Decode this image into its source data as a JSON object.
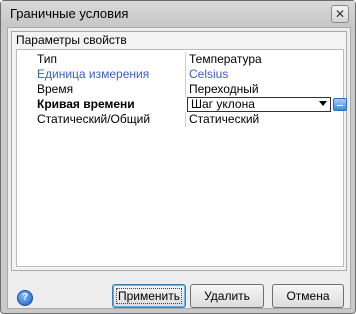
{
  "window": {
    "title": "Граничные условия",
    "close_glyph": "✕"
  },
  "group": {
    "title": "Параметры свойств"
  },
  "properties": [
    {
      "name": "Тип",
      "value": "Температура"
    },
    {
      "name": "Единица измерения",
      "value": "Celsius"
    },
    {
      "name": "Время",
      "value": "Переходный"
    },
    {
      "name": "Кривая времени",
      "value": "Шаг уклона"
    },
    {
      "name": "Статический/Общий",
      "value": "Статический"
    }
  ],
  "buttons": {
    "apply": "Применить",
    "delete": "Удалить",
    "cancel": "Отмена"
  },
  "help": {
    "glyph": "?"
  },
  "colors": {
    "highlight_text": "#3c5fc4",
    "dialog_bg": "#ededed"
  }
}
